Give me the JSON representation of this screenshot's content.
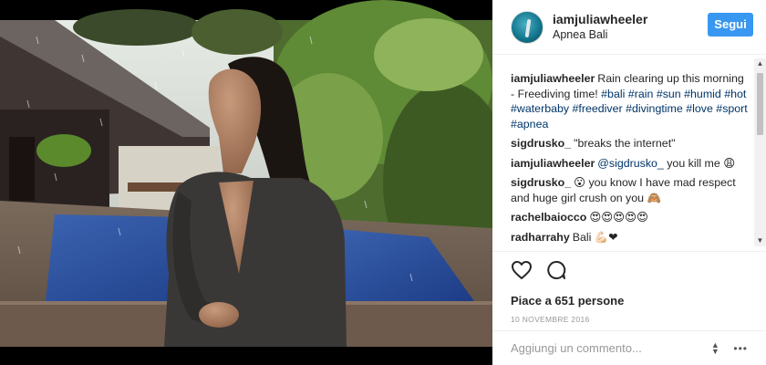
{
  "post": {
    "username": "iamjuliawheeler",
    "location": "Apnea Bali",
    "follow_label": "Segui"
  },
  "comments": [
    {
      "user": "iamjuliawheeler",
      "parts": [
        {
          "t": "text",
          "v": "Rain clearing up this morning - Freediving time! "
        },
        {
          "t": "tag",
          "v": "#bali"
        },
        {
          "t": "text",
          "v": " "
        },
        {
          "t": "tag",
          "v": "#rain"
        },
        {
          "t": "text",
          "v": " "
        },
        {
          "t": "tag",
          "v": "#sun"
        },
        {
          "t": "text",
          "v": " "
        },
        {
          "t": "tag",
          "v": "#humid"
        },
        {
          "t": "text",
          "v": " "
        },
        {
          "t": "tag",
          "v": "#hot"
        },
        {
          "t": "text",
          "v": " "
        },
        {
          "t": "tag",
          "v": "#waterbaby"
        },
        {
          "t": "text",
          "v": " "
        },
        {
          "t": "tag",
          "v": "#freediver"
        },
        {
          "t": "text",
          "v": " "
        },
        {
          "t": "tag",
          "v": "#divingtime"
        },
        {
          "t": "text",
          "v": " "
        },
        {
          "t": "tag",
          "v": "#love"
        },
        {
          "t": "text",
          "v": " "
        },
        {
          "t": "tag",
          "v": "#sport"
        },
        {
          "t": "text",
          "v": " "
        },
        {
          "t": "tag",
          "v": "#apnea"
        }
      ]
    },
    {
      "user": "sigdrusko_",
      "parts": [
        {
          "t": "text",
          "v": "\"breaks the internet\""
        }
      ]
    },
    {
      "user": "iamjuliawheeler",
      "parts": [
        {
          "t": "mention",
          "v": "@sigdrusko_"
        },
        {
          "t": "text",
          "v": " you kill me 😩"
        }
      ]
    },
    {
      "user": "sigdrusko_",
      "parts": [
        {
          "t": "text",
          "v": "😮 you know I have mad respect and huge girl crush on you 🙈"
        }
      ]
    },
    {
      "user": "rachelbaiocco",
      "parts": [
        {
          "t": "text",
          "v": "😍😍😍😍😍"
        }
      ]
    },
    {
      "user": "radharrahy",
      "parts": [
        {
          "t": "text",
          "v": "Bali 💪🏻❤"
        }
      ]
    }
  ],
  "actions": {
    "likes_text": "Piace a 651 persone",
    "date": "10 novembre 2016"
  },
  "comment_box": {
    "placeholder": "Aggiungi un commento...",
    "more": "•••"
  },
  "scrollbar": {
    "up": "▲",
    "down": "▼"
  },
  "colors": {
    "follow_button": "#3897f0",
    "hashtag": "#003569",
    "text": "#262626",
    "muted": "#999999"
  }
}
